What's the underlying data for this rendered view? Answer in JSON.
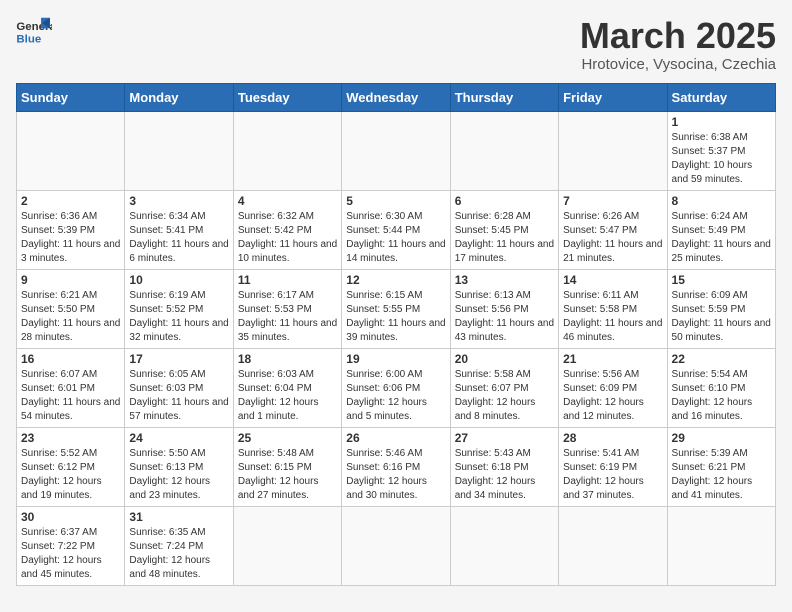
{
  "logo": {
    "text_general": "General",
    "text_blue": "Blue"
  },
  "header": {
    "month_year": "March 2025",
    "location": "Hrotovice, Vysocina, Czechia"
  },
  "weekdays": [
    "Sunday",
    "Monday",
    "Tuesday",
    "Wednesday",
    "Thursday",
    "Friday",
    "Saturday"
  ],
  "weeks": [
    [
      {
        "day": "",
        "info": ""
      },
      {
        "day": "",
        "info": ""
      },
      {
        "day": "",
        "info": ""
      },
      {
        "day": "",
        "info": ""
      },
      {
        "day": "",
        "info": ""
      },
      {
        "day": "",
        "info": ""
      },
      {
        "day": "1",
        "info": "Sunrise: 6:38 AM\nSunset: 5:37 PM\nDaylight: 10 hours and 59 minutes."
      }
    ],
    [
      {
        "day": "2",
        "info": "Sunrise: 6:36 AM\nSunset: 5:39 PM\nDaylight: 11 hours and 3 minutes."
      },
      {
        "day": "3",
        "info": "Sunrise: 6:34 AM\nSunset: 5:41 PM\nDaylight: 11 hours and 6 minutes."
      },
      {
        "day": "4",
        "info": "Sunrise: 6:32 AM\nSunset: 5:42 PM\nDaylight: 11 hours and 10 minutes."
      },
      {
        "day": "5",
        "info": "Sunrise: 6:30 AM\nSunset: 5:44 PM\nDaylight: 11 hours and 14 minutes."
      },
      {
        "day": "6",
        "info": "Sunrise: 6:28 AM\nSunset: 5:45 PM\nDaylight: 11 hours and 17 minutes."
      },
      {
        "day": "7",
        "info": "Sunrise: 6:26 AM\nSunset: 5:47 PM\nDaylight: 11 hours and 21 minutes."
      },
      {
        "day": "8",
        "info": "Sunrise: 6:24 AM\nSunset: 5:49 PM\nDaylight: 11 hours and 25 minutes."
      }
    ],
    [
      {
        "day": "9",
        "info": "Sunrise: 6:21 AM\nSunset: 5:50 PM\nDaylight: 11 hours and 28 minutes."
      },
      {
        "day": "10",
        "info": "Sunrise: 6:19 AM\nSunset: 5:52 PM\nDaylight: 11 hours and 32 minutes."
      },
      {
        "day": "11",
        "info": "Sunrise: 6:17 AM\nSunset: 5:53 PM\nDaylight: 11 hours and 35 minutes."
      },
      {
        "day": "12",
        "info": "Sunrise: 6:15 AM\nSunset: 5:55 PM\nDaylight: 11 hours and 39 minutes."
      },
      {
        "day": "13",
        "info": "Sunrise: 6:13 AM\nSunset: 5:56 PM\nDaylight: 11 hours and 43 minutes."
      },
      {
        "day": "14",
        "info": "Sunrise: 6:11 AM\nSunset: 5:58 PM\nDaylight: 11 hours and 46 minutes."
      },
      {
        "day": "15",
        "info": "Sunrise: 6:09 AM\nSunset: 5:59 PM\nDaylight: 11 hours and 50 minutes."
      }
    ],
    [
      {
        "day": "16",
        "info": "Sunrise: 6:07 AM\nSunset: 6:01 PM\nDaylight: 11 hours and 54 minutes."
      },
      {
        "day": "17",
        "info": "Sunrise: 6:05 AM\nSunset: 6:03 PM\nDaylight: 11 hours and 57 minutes."
      },
      {
        "day": "18",
        "info": "Sunrise: 6:03 AM\nSunset: 6:04 PM\nDaylight: 12 hours and 1 minute."
      },
      {
        "day": "19",
        "info": "Sunrise: 6:00 AM\nSunset: 6:06 PM\nDaylight: 12 hours and 5 minutes."
      },
      {
        "day": "20",
        "info": "Sunrise: 5:58 AM\nSunset: 6:07 PM\nDaylight: 12 hours and 8 minutes."
      },
      {
        "day": "21",
        "info": "Sunrise: 5:56 AM\nSunset: 6:09 PM\nDaylight: 12 hours and 12 minutes."
      },
      {
        "day": "22",
        "info": "Sunrise: 5:54 AM\nSunset: 6:10 PM\nDaylight: 12 hours and 16 minutes."
      }
    ],
    [
      {
        "day": "23",
        "info": "Sunrise: 5:52 AM\nSunset: 6:12 PM\nDaylight: 12 hours and 19 minutes."
      },
      {
        "day": "24",
        "info": "Sunrise: 5:50 AM\nSunset: 6:13 PM\nDaylight: 12 hours and 23 minutes."
      },
      {
        "day": "25",
        "info": "Sunrise: 5:48 AM\nSunset: 6:15 PM\nDaylight: 12 hours and 27 minutes."
      },
      {
        "day": "26",
        "info": "Sunrise: 5:46 AM\nSunset: 6:16 PM\nDaylight: 12 hours and 30 minutes."
      },
      {
        "day": "27",
        "info": "Sunrise: 5:43 AM\nSunset: 6:18 PM\nDaylight: 12 hours and 34 minutes."
      },
      {
        "day": "28",
        "info": "Sunrise: 5:41 AM\nSunset: 6:19 PM\nDaylight: 12 hours and 37 minutes."
      },
      {
        "day": "29",
        "info": "Sunrise: 5:39 AM\nSunset: 6:21 PM\nDaylight: 12 hours and 41 minutes."
      }
    ],
    [
      {
        "day": "30",
        "info": "Sunrise: 6:37 AM\nSunset: 7:22 PM\nDaylight: 12 hours and 45 minutes."
      },
      {
        "day": "31",
        "info": "Sunrise: 6:35 AM\nSunset: 7:24 PM\nDaylight: 12 hours and 48 minutes."
      },
      {
        "day": "",
        "info": ""
      },
      {
        "day": "",
        "info": ""
      },
      {
        "day": "",
        "info": ""
      },
      {
        "day": "",
        "info": ""
      },
      {
        "day": "",
        "info": ""
      }
    ]
  ]
}
